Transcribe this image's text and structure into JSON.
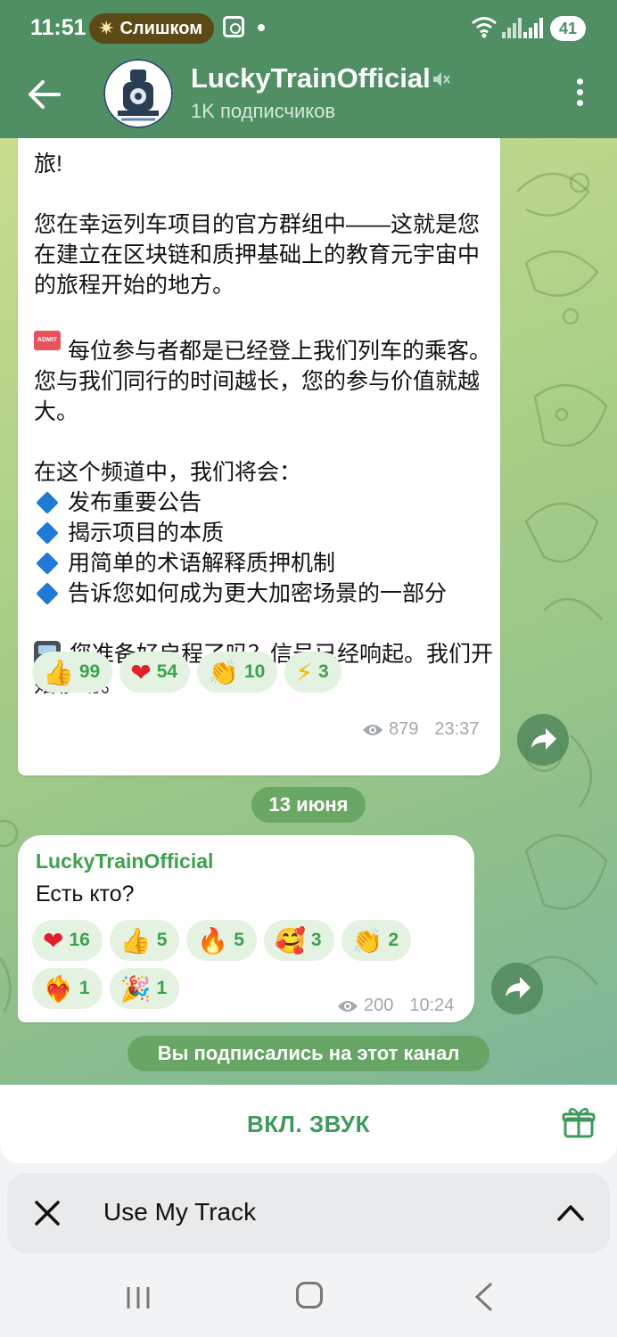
{
  "status_bar": {
    "time": "11:51",
    "notification_pill": "Слишком",
    "battery": "41"
  },
  "header": {
    "title": "LuckyTrainOfficial",
    "subtitle": "1K подписчиков",
    "icons": [
      "back-arrow-icon",
      "avatar-train",
      "mute-icon",
      "more-vert-icon"
    ]
  },
  "messages": [
    {
      "text_top": "旅!\n\n您在幸运列车项目的官方群组中——这就是您在建立在区块链和质押基础上的教育元宇宙中的旅程开始的地方。\n\n",
      "ticket_label": "ADMIT ONE",
      "line_ticket": "每位参与者都是已经登上我们列车的乘客。您与我们同行的时间越长，您的参与价值就越大。",
      "intro": "在这个频道中，我们将会：",
      "bullets": [
        "发布重要公告",
        "揭示项目的本质",
        "用简单的术语解释质押机制",
        "告诉您如何成为更大加密场景的一部分"
      ],
      "line_train": "您准备好启程了吗？信号已经响起。我们开始移动。",
      "reactions": [
        {
          "emoji": "👍",
          "count": "99"
        },
        {
          "emoji": "❤",
          "count": "54"
        },
        {
          "emoji": "👏",
          "count": "10"
        },
        {
          "emoji": "⚡",
          "count": "3"
        }
      ],
      "views": "879",
      "time": "23:37"
    },
    {
      "date_separator": "13 июня",
      "author": "LuckyTrainOfficial",
      "text": "Есть кто?",
      "reactions": [
        {
          "emoji": "❤",
          "count": "16"
        },
        {
          "emoji": "👍",
          "count": "5"
        },
        {
          "emoji": "🔥",
          "count": "5"
        },
        {
          "emoji": "🥰",
          "count": "3"
        },
        {
          "emoji": "👏",
          "count": "2"
        },
        {
          "emoji": "❤‍🔥",
          "count": "1"
        },
        {
          "emoji": "🎉",
          "count": "1"
        }
      ],
      "views": "200",
      "time": "10:24"
    }
  ],
  "system_message": "Вы подписались на этот канал",
  "bottom": {
    "sound_button": "ВКЛ. ЗВУК",
    "media_title": "Use My Track"
  },
  "colors": {
    "header": "#4f8f63",
    "accent_green": "#3ea14d",
    "reaction_bg": "#e4f2e1"
  }
}
